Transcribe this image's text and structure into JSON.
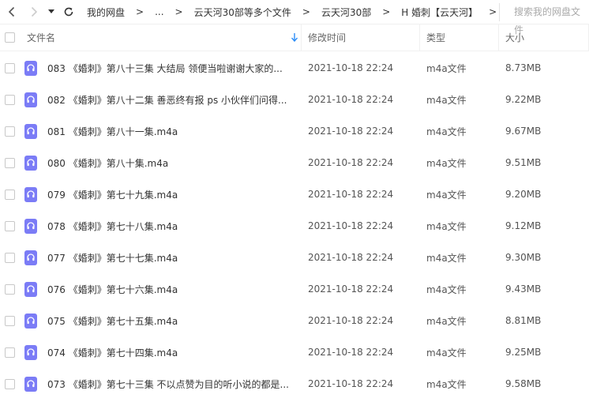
{
  "nav": {
    "breadcrumbs": [
      "我的网盘",
      "...",
      "云天河30部等多个文件",
      "云天河30部",
      "H 婚刺【云天河】"
    ],
    "search_placeholder": "搜索我的网盘文件"
  },
  "columns": {
    "name": "文件名",
    "time": "修改时间",
    "type": "类型",
    "size": "大小"
  },
  "files": [
    {
      "name": "083 《婚刺》第八十三集  大结局  领便当啦谢谢大家的...",
      "time": "2021-10-18 22:24",
      "type": "m4a文件",
      "size": "8.73MB"
    },
    {
      "name": "082 《婚刺》第八十二集  善恶终有报  ps  小伙伴们问得...",
      "time": "2021-10-18 22:24",
      "type": "m4a文件",
      "size": "9.22MB"
    },
    {
      "name": "081 《婚刺》第八十一集.m4a",
      "time": "2021-10-18 22:24",
      "type": "m4a文件",
      "size": "9.67MB"
    },
    {
      "name": "080 《婚刺》第八十集.m4a",
      "time": "2021-10-18 22:24",
      "type": "m4a文件",
      "size": "9.51MB"
    },
    {
      "name": "079 《婚刺》第七十九集.m4a",
      "time": "2021-10-18 22:24",
      "type": "m4a文件",
      "size": "9.20MB"
    },
    {
      "name": "078 《婚刺》第七十八集.m4a",
      "time": "2021-10-18 22:24",
      "type": "m4a文件",
      "size": "9.12MB"
    },
    {
      "name": "077 《婚刺》第七十七集.m4a",
      "time": "2021-10-18 22:24",
      "type": "m4a文件",
      "size": "9.30MB"
    },
    {
      "name": "076 《婚刺》第七十六集.m4a",
      "time": "2021-10-18 22:24",
      "type": "m4a文件",
      "size": "9.43MB"
    },
    {
      "name": "075 《婚刺》第七十五集.m4a",
      "time": "2021-10-18 22:24",
      "type": "m4a文件",
      "size": "8.81MB"
    },
    {
      "name": "074 《婚刺》第七十四集.m4a",
      "time": "2021-10-18 22:24",
      "type": "m4a文件",
      "size": "9.25MB"
    },
    {
      "name": "073 《婚刺》第七十三集  不以点赞为目的听小说的都是...",
      "time": "2021-10-18 22:24",
      "type": "m4a文件",
      "size": "9.58MB"
    }
  ],
  "icons": {
    "back": "chevron-left-icon",
    "forward": "chevron-right-icon",
    "history": "caret-down-icon",
    "refresh": "refresh-icon",
    "file": "audio-file-icon",
    "sort": "arrow-down-icon"
  },
  "colors": {
    "accent": "#2e8ef7",
    "audio_icon": "#7b7cf6"
  }
}
